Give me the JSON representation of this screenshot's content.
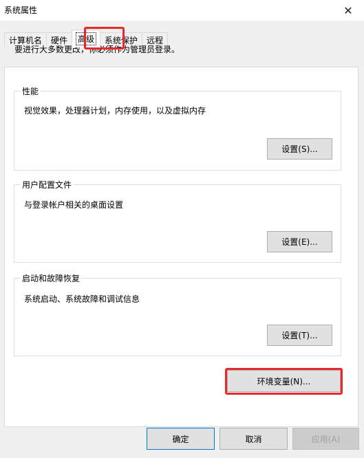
{
  "window": {
    "title": "系统属性",
    "close_glyph": "✕"
  },
  "tabs": [
    {
      "label": "计算机名"
    },
    {
      "label": "硬件"
    },
    {
      "label": "高级"
    },
    {
      "label": "系统保护"
    },
    {
      "label": "远程"
    }
  ],
  "active_tab": "高级",
  "admin_note": "要进行大多数更改，你必须作为管理员登录。",
  "groups": {
    "performance": {
      "title": "性能",
      "desc": "视觉效果，处理器计划，内存使用，以及虚拟内存",
      "button": "设置(S)..."
    },
    "user_profiles": {
      "title": "用户配置文件",
      "desc": "与登录帐户相关的桌面设置",
      "button": "设置(E)..."
    },
    "startup_recovery": {
      "title": "启动和故障恢复",
      "desc": "系统启动、系统故障和调试信息",
      "button": "设置(T)..."
    }
  },
  "env_button": "环境变量(N)...",
  "footer": {
    "ok": "确定",
    "cancel": "取消",
    "apply": "应用(A)"
  },
  "highlight_color": "#e8282a"
}
